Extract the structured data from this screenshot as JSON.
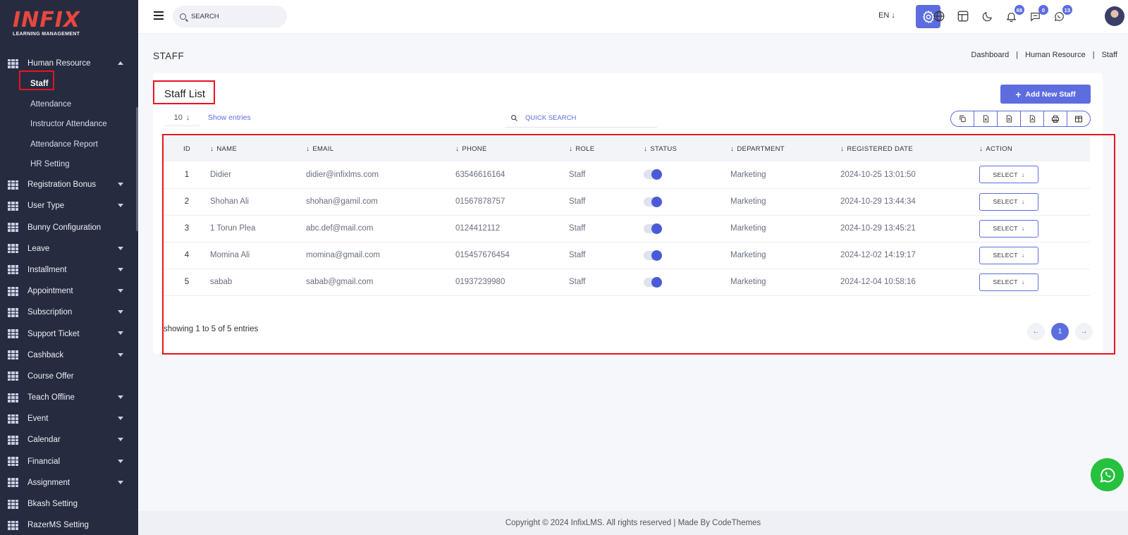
{
  "brand": {
    "name": "INFIX",
    "tagline": "LEARNING MANAGEMENT"
  },
  "sidebar": {
    "group": {
      "label": "Human Resource"
    },
    "sub_items": [
      {
        "label": "Staff"
      },
      {
        "label": "Attendance"
      },
      {
        "label": "Instructor Attendance"
      },
      {
        "label": "Attendance Report"
      },
      {
        "label": "HR Setting"
      }
    ],
    "items": [
      {
        "label": "Registration Bonus"
      },
      {
        "label": "User Type"
      },
      {
        "label": "Bunny Configuration"
      },
      {
        "label": "Leave"
      },
      {
        "label": "Installment"
      },
      {
        "label": "Appointment"
      },
      {
        "label": "Subscription"
      },
      {
        "label": "Support Ticket"
      },
      {
        "label": "Cashback"
      },
      {
        "label": "Course Offer"
      },
      {
        "label": "Teach Offline"
      },
      {
        "label": "Event"
      },
      {
        "label": "Calendar"
      },
      {
        "label": "Financial"
      },
      {
        "label": "Assignment"
      },
      {
        "label": "Bkash Setting"
      },
      {
        "label": "RazerMS Setting"
      }
    ]
  },
  "header": {
    "search_placeholder": "SEARCH",
    "language": "EN",
    "badges": {
      "notifications": "68",
      "messages": "0",
      "chat": "13"
    }
  },
  "page": {
    "title": "STAFF",
    "breadcrumb": [
      "Dashboard",
      "Human Resource",
      "Staff"
    ]
  },
  "card": {
    "title": "Staff List",
    "add_button": "Add New Staff",
    "entries_value": "10",
    "entries_label": "Show entries",
    "quick_search_placeholder": "QUICK SEARCH"
  },
  "table": {
    "headers": [
      "ID",
      "NAME",
      "EMAIL",
      "PHONE",
      "ROLE",
      "STATUS",
      "DEPARTMENT",
      "REGISTERED DATE",
      "ACTION"
    ],
    "rows": [
      {
        "id": "1",
        "name": "Didier",
        "email": "didier@infixlms.com",
        "phone": "63546616164",
        "role": "Staff",
        "department": "Marketing",
        "registered": "2024-10-25 13:01:50",
        "action": "SELECT"
      },
      {
        "id": "2",
        "name": "Shohan Ali",
        "email": "shohan@gamil.com",
        "phone": "01567878757",
        "role": "Staff",
        "department": "Marketing",
        "registered": "2024-10-29 13:44:34",
        "action": "SELECT"
      },
      {
        "id": "3",
        "name": "1 Torun Plea",
        "email": "abc.def@mail.com",
        "phone": "0124412112",
        "role": "Staff",
        "department": "Marketing",
        "registered": "2024-10-29 13:45:21",
        "action": "SELECT"
      },
      {
        "id": "4",
        "name": "Momina Ali",
        "email": "momina@gmail.com",
        "phone": "015457676454",
        "role": "Staff",
        "department": "Marketing",
        "registered": "2024-12-02 14:19:17",
        "action": "SELECT"
      },
      {
        "id": "5",
        "name": "sabab",
        "email": "sabab@gmail.com",
        "phone": "01937239980",
        "role": "Staff",
        "department": "Marketing",
        "registered": "2024-12-04 10:58:16",
        "action": "SELECT"
      }
    ]
  },
  "pagination": {
    "showing": "showing 1 to 5 of 5 entries",
    "current": "1"
  },
  "footer": {
    "text": "Copyright © 2024 InfixLMS. All rights reserved | Made By CodeThemes"
  },
  "colors": {
    "accent": "#5d6de0",
    "sidebar": "#262b40",
    "highlight": "#e8141f",
    "whatsapp": "#25c13f"
  }
}
